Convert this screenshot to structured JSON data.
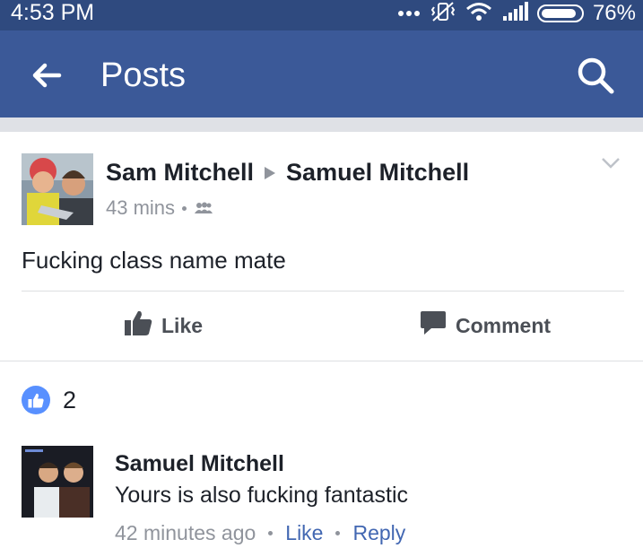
{
  "status_bar": {
    "time": "4:53 PM",
    "battery": "76%",
    "icons": [
      "more-dots-icon",
      "vibrate-icon",
      "wifi-icon",
      "signal-icon",
      "battery-icon"
    ]
  },
  "app_bar": {
    "title": "Posts",
    "back_icon": "back-arrow-icon",
    "search_icon": "search-icon",
    "color": "#3b5998"
  },
  "post": {
    "author": "Sam Mitchell",
    "target": "Samuel Mitchell",
    "time": "43 mins",
    "audience_icon": "friends-icon",
    "text": "Fucking class name mate",
    "actions": {
      "like": "Like",
      "comment": "Comment"
    }
  },
  "reactions": {
    "count": "2",
    "icon": "like-icon",
    "color": "#5890ff"
  },
  "comment": {
    "author": "Samuel Mitchell",
    "text": "Yours is also fucking fantastic",
    "time": "42 minutes ago",
    "like": "Like",
    "reply": "Reply",
    "link_color": "#4267b2"
  }
}
